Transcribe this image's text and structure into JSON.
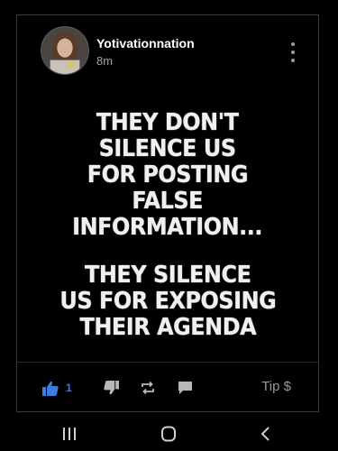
{
  "post": {
    "author": "Yotivationnation",
    "timestamp": "8m",
    "image_text": {
      "lines_top": [
        "THEY DON'T",
        "SILENCE US",
        "FOR POSTING",
        "FALSE",
        "INFORMATION..."
      ],
      "lines_bottom": [
        "THEY SILENCE",
        "US FOR EXPOSING",
        "THEIR AGENDA"
      ]
    },
    "actions": {
      "like_count": "1",
      "tip_label": "Tip $"
    }
  },
  "icons": {
    "more": "vertical-ellipsis-icon",
    "like": "thumbs-up-icon",
    "dislike": "thumbs-down-icon",
    "repost": "repost-icon",
    "comment": "comment-icon",
    "nav_recent": "recent-apps-icon",
    "nav_home": "home-icon",
    "nav_back": "back-icon"
  },
  "colors": {
    "background": "#000000",
    "accent_like": "#3b7ddd",
    "muted": "#9a9a9a",
    "card_border": "#3a3a3a"
  }
}
